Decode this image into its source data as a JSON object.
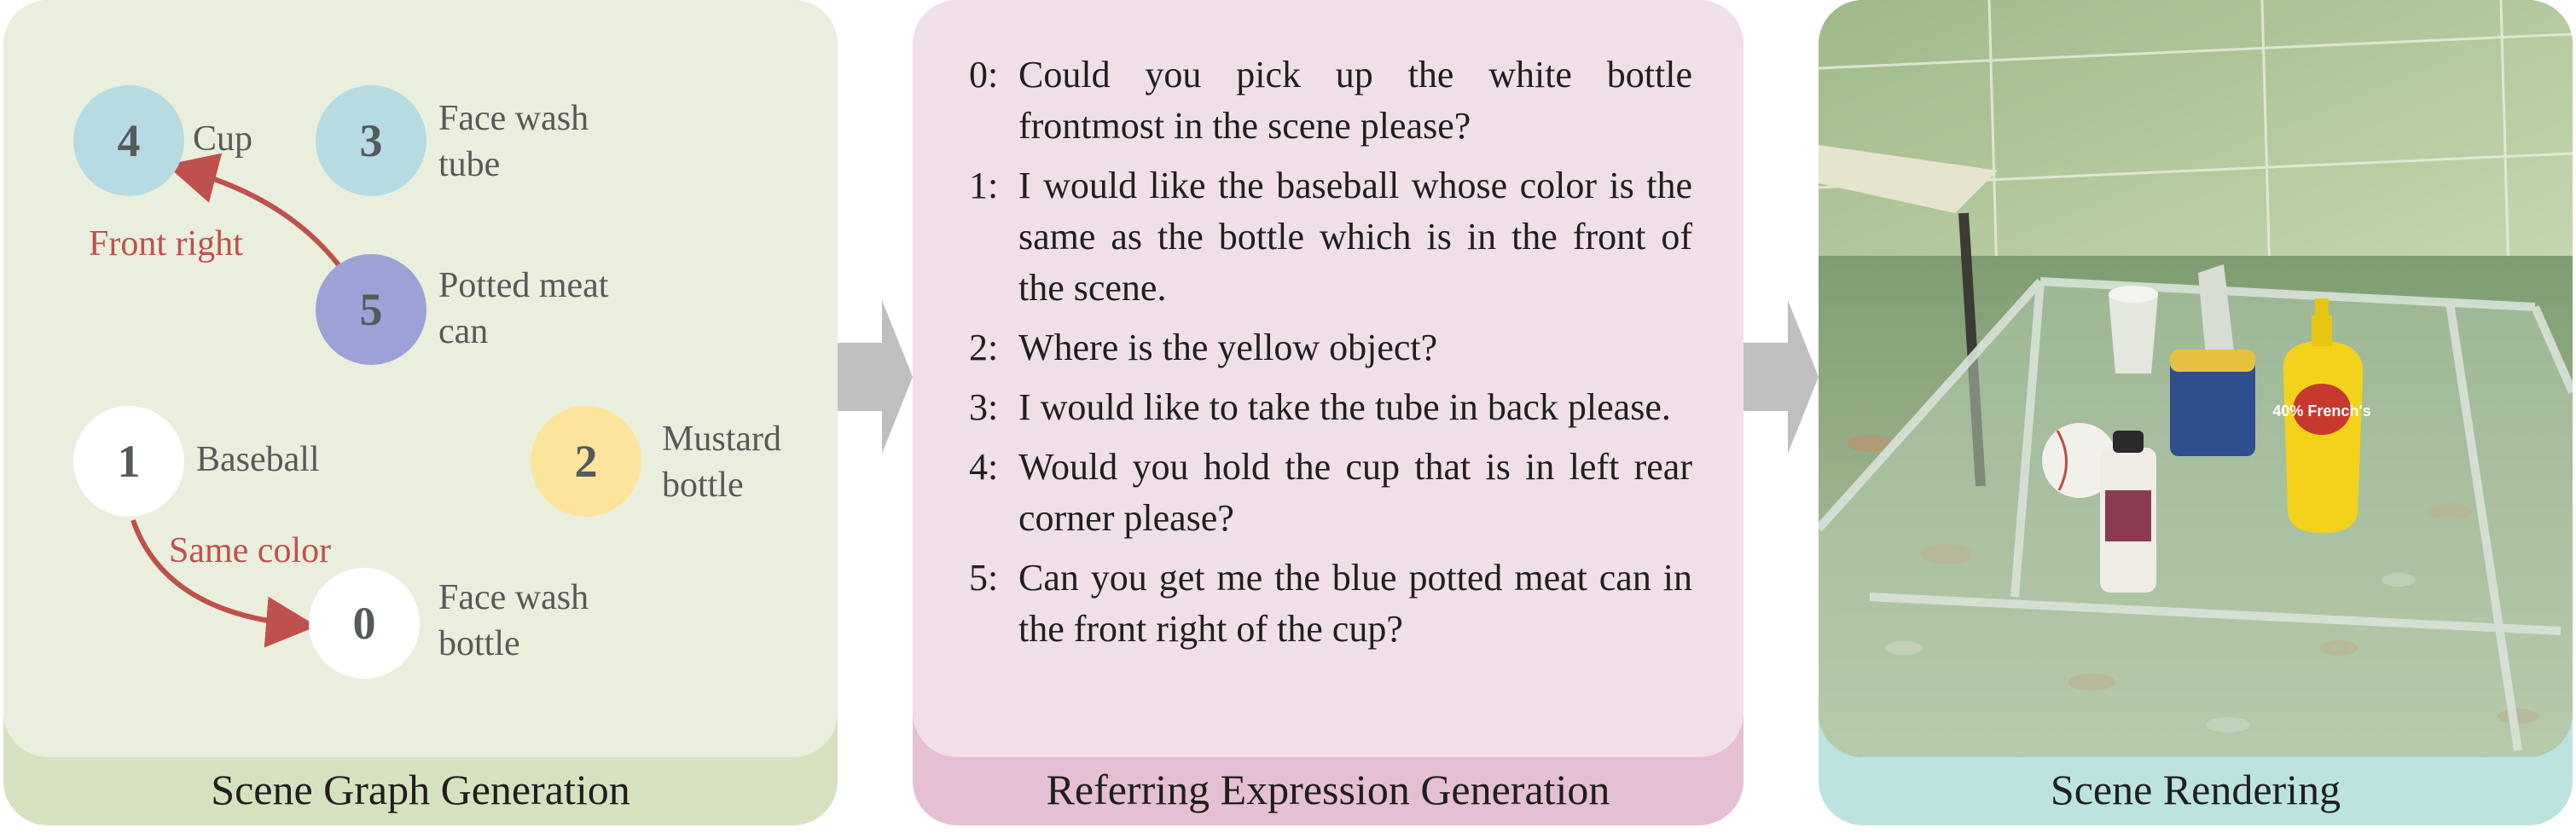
{
  "panels": {
    "scene_graph": {
      "caption": "Scene Graph Generation",
      "nodes": [
        {
          "id": "4",
          "label": "Cup",
          "color": "#b7dbe3"
        },
        {
          "id": "3",
          "label": "Face wash tube",
          "color": "#b7dbe3"
        },
        {
          "id": "5",
          "label": "Potted meat can",
          "color": "#9da2d6"
        },
        {
          "id": "1",
          "label": "Baseball",
          "color": "#ffffff"
        },
        {
          "id": "2",
          "label": "Mustard bottle",
          "color": "#fde49b"
        },
        {
          "id": "0",
          "label": "Face wash bottle",
          "color": "#ffffff"
        }
      ],
      "edges": [
        {
          "from": "5",
          "to": "4",
          "label": "Front right"
        },
        {
          "from": "1",
          "to": "0",
          "label": "Same color"
        }
      ],
      "edge_color": "#c0504d"
    },
    "referring": {
      "caption": "Referring Expression Generation",
      "expressions": [
        {
          "num": "0:",
          "text": "Could you pick up the white bottle frontmost in the scene please?"
        },
        {
          "num": "1:",
          "text": "I would like the baseball whose color is the same as the bottle which is in the front of the scene."
        },
        {
          "num": "2:",
          "text": "Where is the yellow object?"
        },
        {
          "num": "3:",
          "text": "I would like to take the tube in back please."
        },
        {
          "num": "4:",
          "text": "Would you hold the cup that is in left rear corner please?"
        },
        {
          "num": "5:",
          "text": "Can you get me the blue potted meat can in the front right of the cup?"
        }
      ]
    },
    "rendering": {
      "caption": "Scene Rendering",
      "mustard_label": "40% French's"
    }
  },
  "colors": {
    "scene_graph_bg": "#e9efdc",
    "scene_graph_footer": "#d6e2bf",
    "referring_bg": "#f0dfe8",
    "referring_footer": "#e5bfd3",
    "rendering_footer": "#bde3e0",
    "arrow": "#bfbfbf"
  }
}
